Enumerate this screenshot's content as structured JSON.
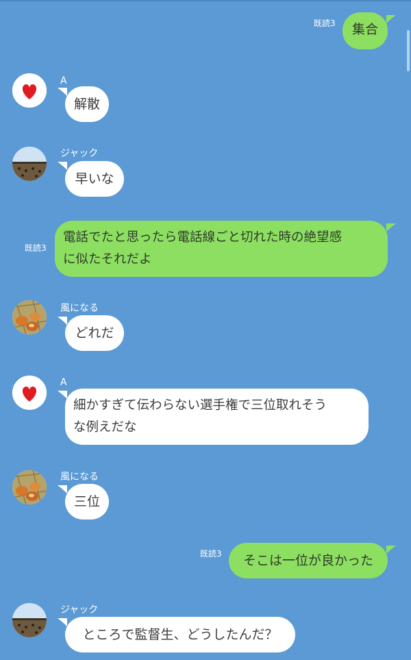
{
  "messages": [
    {
      "side": "out",
      "read": "既読3",
      "text": "集合"
    },
    {
      "side": "in",
      "sender": "A",
      "avatar": "heart-avatar",
      "text": "解散"
    },
    {
      "side": "in",
      "sender": "ジャック",
      "avatar": "stadium-avatar",
      "text": "早いな"
    },
    {
      "side": "out",
      "read": "既読3",
      "text": "電話でたと思ったら電話線ごと切れた時の絶望感\nに似たそれだよ"
    },
    {
      "side": "in",
      "sender": "風になる",
      "avatar": "egg-nest-avatar",
      "text": "どれだ"
    },
    {
      "side": "in",
      "sender": "A",
      "avatar": "heart-avatar",
      "text": "細かすぎて伝わらない選手権で三位取れそう\nな例えだな"
    },
    {
      "side": "in",
      "sender": "風になる",
      "avatar": "egg-nest-avatar",
      "text": "三位"
    },
    {
      "side": "out",
      "read": "既読3",
      "text": "そこは一位が良かった"
    },
    {
      "side": "in",
      "sender": "ジャック",
      "avatar": "stadium-avatar",
      "text": "ところで監督生、どうしたんだ？"
    }
  ],
  "colors": {
    "background": "#5b9ad4",
    "incoming_bubble": "#ffffff",
    "outgoing_bubble": "#8ddf62",
    "heart": "#e11b22"
  }
}
